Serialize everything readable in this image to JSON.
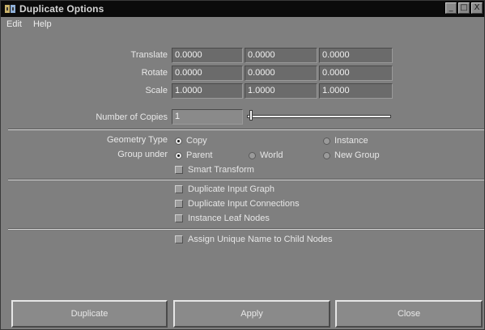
{
  "window": {
    "title": "Duplicate Options",
    "controls": [
      "_",
      "□",
      "X"
    ]
  },
  "menu": [
    "Edit",
    "Help"
  ],
  "translate": {
    "label": "Translate",
    "values": [
      "0.0000",
      "0.0000",
      "0.0000"
    ]
  },
  "rotate": {
    "label": "Rotate",
    "values": [
      "0.0000",
      "0.0000",
      "0.0000"
    ]
  },
  "scale": {
    "label": "Scale",
    "values": [
      "1.0000",
      "1.0000",
      "1.0000"
    ]
  },
  "copies": {
    "label": "Number of Copies",
    "value": "1",
    "slider_value": 1
  },
  "geometry_type": {
    "label": "Geometry Type",
    "options": [
      {
        "label": "Copy",
        "selected": true
      },
      {
        "label": "Instance",
        "selected": false
      }
    ]
  },
  "group_under": {
    "label": "Group under",
    "options": [
      {
        "label": "Parent",
        "selected": true
      },
      {
        "label": "World",
        "selected": false
      },
      {
        "label": "New Group",
        "selected": false
      }
    ]
  },
  "checkboxes": [
    {
      "label": "Smart Transform",
      "checked": false
    },
    {
      "label": "Duplicate Input Graph",
      "checked": false
    },
    {
      "label": "Duplicate Input Connections",
      "checked": false
    },
    {
      "label": "Instance Leaf Nodes",
      "checked": false
    },
    {
      "label": "Assign Unique Name to Child Nodes",
      "checked": false
    }
  ],
  "buttons": {
    "duplicate": "Duplicate",
    "apply": "Apply",
    "close": "Close"
  }
}
